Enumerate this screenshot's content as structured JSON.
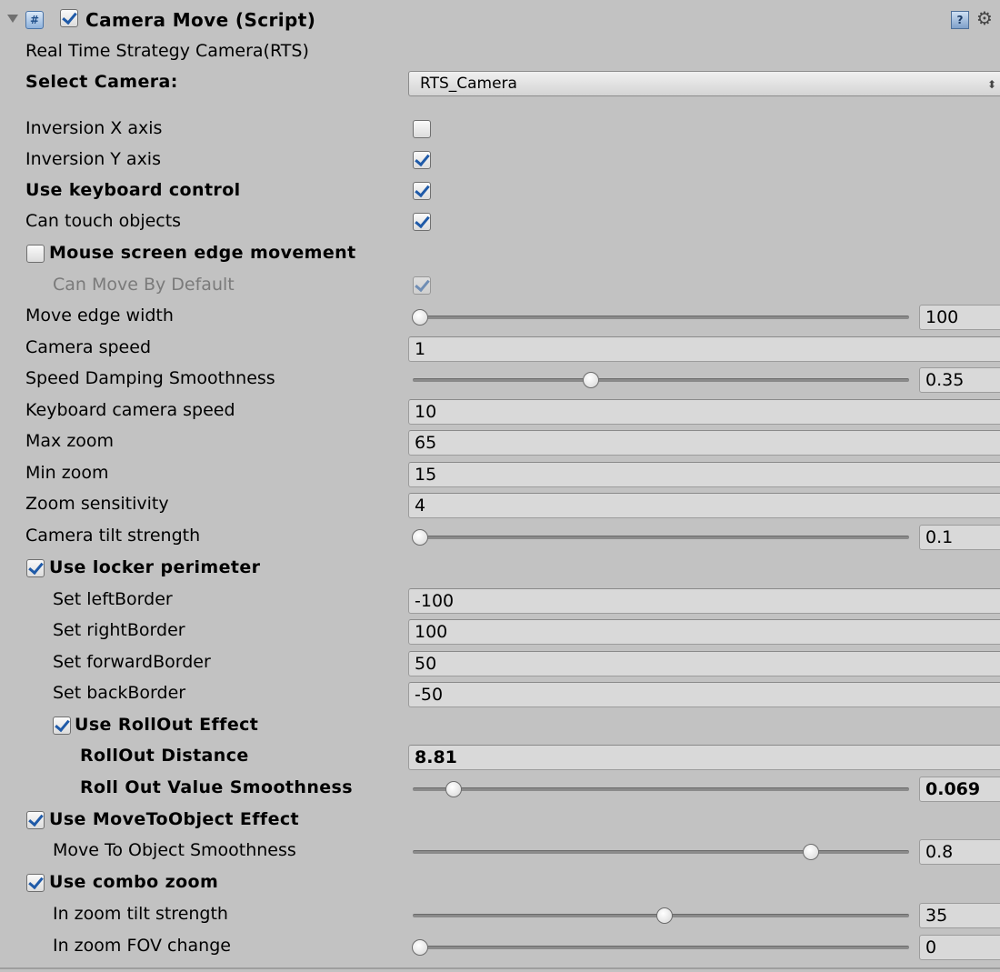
{
  "header": {
    "title": "Camera Move (Script)",
    "enabled": true,
    "script_icon_glyph": "#",
    "help_icon_glyph": "?",
    "gear_icon_glyph": "⚙"
  },
  "subtitle": "Real Time Strategy Camera(RTS)",
  "select_camera": {
    "label": "Select Camera:",
    "value": "RTS_Camera",
    "arrow": "⬍"
  },
  "toggles": {
    "inversion_x": {
      "label": "Inversion X axis",
      "checked": false
    },
    "inversion_y": {
      "label": "Inversion Y axis",
      "checked": true
    },
    "keyboard_control": {
      "label": "Use keyboard control",
      "checked": true
    },
    "touch_objects": {
      "label": "Can touch objects",
      "checked": true
    },
    "mouse_edge": {
      "label": "Mouse screen edge movement",
      "checked": false
    },
    "move_by_default": {
      "label": "Can Move By Default",
      "checked": true
    }
  },
  "fields": {
    "move_edge_width": {
      "label": "Move edge width",
      "value": "100",
      "fraction": 0.0
    },
    "camera_speed": {
      "label": "Camera speed",
      "value": "1"
    },
    "speed_damping": {
      "label": "Speed Damping Smoothness",
      "value": "0.35",
      "fraction": 0.35
    },
    "keyboard_speed": {
      "label": "Keyboard camera speed",
      "value": "10"
    },
    "max_zoom": {
      "label": "Max zoom",
      "value": "65"
    },
    "min_zoom": {
      "label": "Min zoom",
      "value": "15"
    },
    "zoom_sensitivity": {
      "label": "Zoom sensitivity",
      "value": "4"
    },
    "tilt_strength": {
      "label": "Camera tilt strength",
      "value": "0.1",
      "fraction": 0.0
    }
  },
  "locker": {
    "label": "Use locker perimeter",
    "checked": true,
    "left_border": {
      "label": "Set leftBorder",
      "value": "-100"
    },
    "right_border": {
      "label": "Set rightBorder",
      "value": "100"
    },
    "forward_border": {
      "label": "Set forwardBorder",
      "value": "50"
    },
    "back_border": {
      "label": "Set backBorder",
      "value": "-50"
    }
  },
  "rollout": {
    "label": "Use RollOut Effect",
    "checked": true,
    "distance": {
      "label": "RollOut Distance",
      "value": "8.81"
    },
    "smoothness": {
      "label": "Roll Out Value Smoothness",
      "value": "0.069",
      "fraction": 0.069
    }
  },
  "move_to_object": {
    "label": "Use MoveToObject Effect",
    "checked": true,
    "smoothness": {
      "label": "Move To Object Smoothness",
      "value": "0.8",
      "fraction": 0.8
    }
  },
  "combo_zoom": {
    "label": "Use combo zoom",
    "checked": true,
    "tilt_strength": {
      "label": "In zoom tilt  strength",
      "value": "35",
      "fraction": 0.5
    },
    "fov_change": {
      "label": "In zoom FOV change",
      "value": "0",
      "fraction": 0.0
    }
  }
}
